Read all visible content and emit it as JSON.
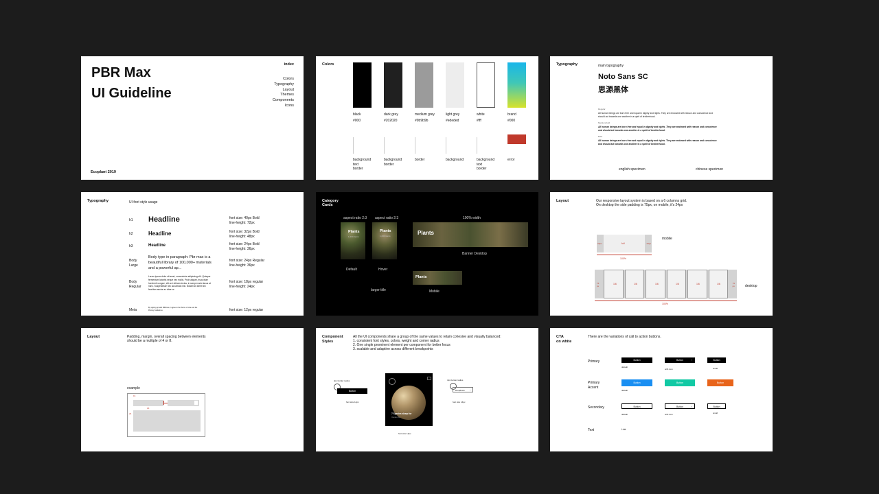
{
  "cover": {
    "title_line1": "PBR Max",
    "title_line2": "UI Guideline",
    "index_label": "index",
    "index_items": [
      "Colors",
      "Typography",
      "Layout",
      "Themes",
      "Components",
      "Icons"
    ],
    "footer": "Ecoplant 2019"
  },
  "colors": {
    "heading": "Colors",
    "swatches": [
      {
        "name": "black",
        "hex": "#000",
        "color": "#000000"
      },
      {
        "name": "dark grey",
        "hex": "#202020",
        "color": "#202020"
      },
      {
        "name": "medium grey",
        "hex": "#9b9b9b",
        "color": "#9b9b9b"
      },
      {
        "name": "light grey",
        "hex": "#ededed",
        "color": "#ededed"
      },
      {
        "name": "white",
        "hex": "#fff",
        "color": "#ffffff"
      },
      {
        "name": "brand",
        "hex": "#000",
        "color": "gradient"
      }
    ],
    "usage": [
      "background\ntext\nborder",
      "background\nborder",
      "border",
      "background",
      "background\ntext\nborder",
      "error"
    ],
    "error_color": "#c0392b"
  },
  "typo1": {
    "heading": "Typography",
    "main_label": "main typography",
    "font_name": "Noto Sans SC",
    "font_name_cn": "思源黑体",
    "spec_labels": [
      "Regular",
      "Medium/bold",
      "Bold"
    ],
    "spec_text": "All human beings are born free and equal in dignity and rights. They are endowed with reason and conscience and should act towards one another in a spirit of brotherhood.",
    "english_label": "english specimen",
    "chinese_label": "chinese specimen"
  },
  "typo2": {
    "heading": "Typography",
    "subheading": "UI font style usage",
    "rows": [
      {
        "tag": "h1",
        "sample": "Headline",
        "spec": "font size: 40px Bold\nline-height: 72px"
      },
      {
        "tag": "h2",
        "sample": "Headline",
        "spec": "font size: 32px Bold\nline-height: 48px"
      },
      {
        "tag": "h3",
        "sample": "Headline",
        "spec": "font size: 24px Bold\nline-height: 36px"
      },
      {
        "tag": "Body\nLarge",
        "sample": "Body type in paragraph: Pbr max is a beautiful library of 100,000+ materials and a powerful ap...",
        "spec": "font size: 24px Regular\nline-height: 36px"
      },
      {
        "tag": "Body\nRegular",
        "sample": "Lorem ipsum dolor sit amet, consectetur adipiscing elit. Quisque fermentum lobortis neque nec mollis. Proin aliquet, risus vitae hendrerit congue, elit orci ultrices lectus, in semper ante lacus at nunc. Suspendisse nec accumsan nisi. Nullam sit amet nisi faucibus auctor ac vitae ve",
        "spec": "font size: 18px regular\nline-height: 24px"
      },
      {
        "tag": "Meta",
        "sample": "By signing up with PBRmax, I agree to the Terms of Use and the Privacy Guidelines",
        "spec": "font size: 12px regular"
      }
    ]
  },
  "cards": {
    "heading": "Category\nCards",
    "ratio1": "aspect ratio 2:3",
    "ratio2": "aspect ratio 2:3",
    "full_width": "100% width",
    "card_title": "Plants",
    "card_sub": "1,234 items",
    "default_label": "Default",
    "hover_label": "Hover",
    "banner_label": "Banner Desktop",
    "larger_title": "larger title",
    "mobile_label": "Mobile"
  },
  "layout1": {
    "heading": "Layout",
    "desc_line1": "Our responsive layout system is based on a 6 columns grid.",
    "desc_line2": "On desktop the side padding is 75px, on mobile, it's 24px",
    "mobile_label": "mobile",
    "desktop_label": "desktop",
    "mobile_side": "24px",
    "mobile_mid": "full",
    "desktop_side": "75\npx",
    "desktop_col": "1/6",
    "percent": "100%"
  },
  "layout2": {
    "heading": "Layout",
    "desc_line1": "Padding, margin, overall spacing between elements",
    "desc_line2": "should be a multiple of 4 or 8.",
    "example_label": "example",
    "m1": "16",
    "m2": "16",
    "m3": "24"
  },
  "components": {
    "heading": "Component\nStyles",
    "intro": "All the UI components share a group of the same values to retain cohesive and visually balanced:",
    "points": [
      "1. consistent font styles, colors, weight and corner radius",
      "2. One single prominent element per component for better focus",
      "3. scalable and adaptive across different breakpoints"
    ],
    "btn_label": "Button",
    "radius_label": "4px border radius",
    "font_label": "font size 14px",
    "card_title": "7 Species sharp for",
    "card_sub": "Vendor Art",
    "card_font_label": "font size 14px",
    "dropdown_label": "Dropdown",
    "dropdown_radius": "4px border radius",
    "dropdown_font": "font size 14px"
  },
  "cta": {
    "heading": "CTA\non white",
    "intro": "There are the variations of call to action buttons.",
    "rows": [
      {
        "name": "Primary",
        "buttons": [
          "Button",
          "Button",
          "Button"
        ],
        "subs": [
          "default",
          "with icon",
          "small"
        ]
      },
      {
        "name": "Primary\nAccent",
        "buttons": [
          "Button",
          "Button",
          "Button"
        ],
        "subs": [
          "default",
          "",
          ""
        ]
      },
      {
        "name": "Secondary",
        "buttons": [
          "Button",
          "Button",
          "Button"
        ],
        "subs": [
          "default",
          "with icon",
          "small"
        ]
      },
      {
        "name": "Text",
        "buttons": [
          "Link"
        ],
        "subs": [
          ""
        ]
      }
    ],
    "accent_colors": [
      "#1a8ff2",
      "#12c9a4",
      "#e8641b"
    ]
  }
}
